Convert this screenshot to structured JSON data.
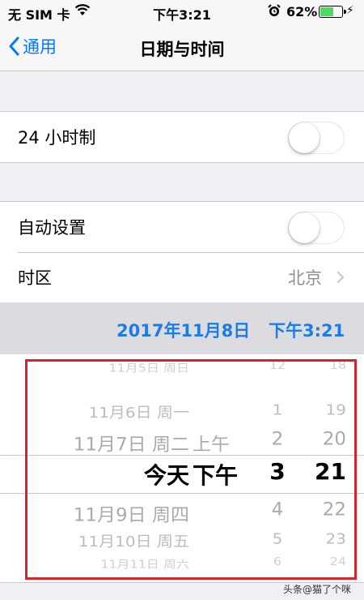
{
  "status_bar": {
    "carrier": "无 SIM 卡",
    "time": "下午3:21",
    "battery_percent": "62%",
    "battery_level": 0.62,
    "icons": [
      "wifi-icon",
      "alarm-icon",
      "battery-icon",
      "charging-bolt-icon"
    ]
  },
  "nav": {
    "back_label": "通用",
    "title": "日期与时间"
  },
  "settings": {
    "hour24": {
      "label": "24 小时制",
      "on": false
    },
    "auto_set": {
      "label": "自动设置",
      "on": false
    },
    "timezone": {
      "label": "时区",
      "value": "北京"
    }
  },
  "date_summary": {
    "date": "2017年11月8日",
    "time": "下午3:21"
  },
  "picker": {
    "rows": [
      {
        "day": "11月5日 周日",
        "ampm": "",
        "hour": "12",
        "minute": "18"
      },
      {
        "day": "11月6日 周一",
        "ampm": "",
        "hour": "1",
        "minute": "19"
      },
      {
        "day": "11月7日 周二",
        "ampm": "上午",
        "hour": "2",
        "minute": "20"
      },
      {
        "day": "今天",
        "ampm": "下午",
        "hour": "3",
        "minute": "21"
      },
      {
        "day": "11月9日 周四",
        "ampm": "",
        "hour": "4",
        "minute": "22"
      },
      {
        "day": "11月10日 周五",
        "ampm": "",
        "hour": "5",
        "minute": "23"
      },
      {
        "day": "11月11日 周六",
        "ampm": "",
        "hour": "6",
        "minute": "24"
      }
    ],
    "selected_index": 3
  },
  "colors": {
    "accent": "#007aff",
    "date_text": "#1a7ce8",
    "highlight_box": "#d9232a",
    "battery_fill": "#4cd964"
  },
  "watermark": "头条@猫了个咪"
}
